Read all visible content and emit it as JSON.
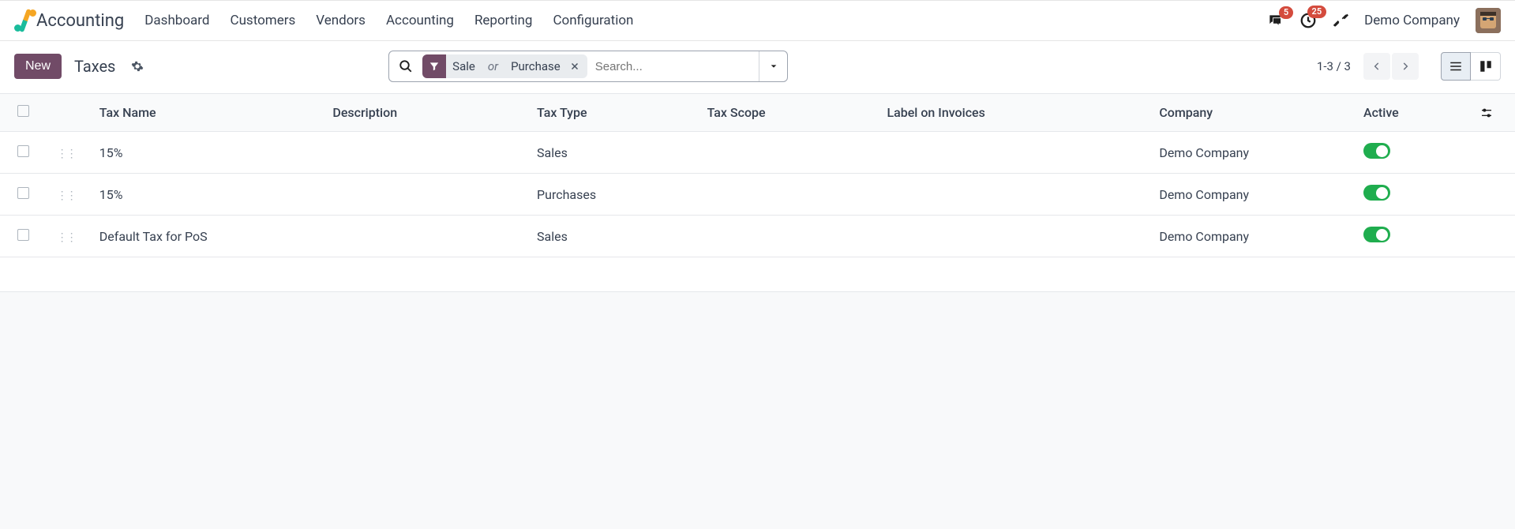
{
  "topnav": {
    "app_name": "Accounting",
    "menu": [
      "Dashboard",
      "Customers",
      "Vendors",
      "Accounting",
      "Reporting",
      "Configuration"
    ],
    "messages_badge": "5",
    "activities_badge": "25",
    "company": "Demo Company"
  },
  "control": {
    "new_label": "New",
    "breadcrumb": "Taxes",
    "facet_a": "Sale",
    "facet_or": "or",
    "facet_b": "Purchase",
    "search_placeholder": "Search...",
    "pager": "1-3 / 3"
  },
  "table": {
    "headers": {
      "name": "Tax Name",
      "desc": "Description",
      "type": "Tax Type",
      "scope": "Tax Scope",
      "label": "Label on Invoices",
      "company": "Company",
      "active": "Active"
    },
    "rows": [
      {
        "name": "15%",
        "desc": "",
        "type": "Sales",
        "scope": "",
        "label": "",
        "company": "Demo Company",
        "active": true
      },
      {
        "name": "15%",
        "desc": "",
        "type": "Purchases",
        "scope": "",
        "label": "",
        "company": "Demo Company",
        "active": true
      },
      {
        "name": "Default Tax for PoS",
        "desc": "",
        "type": "Sales",
        "scope": "",
        "label": "",
        "company": "Demo Company",
        "active": true
      }
    ]
  }
}
